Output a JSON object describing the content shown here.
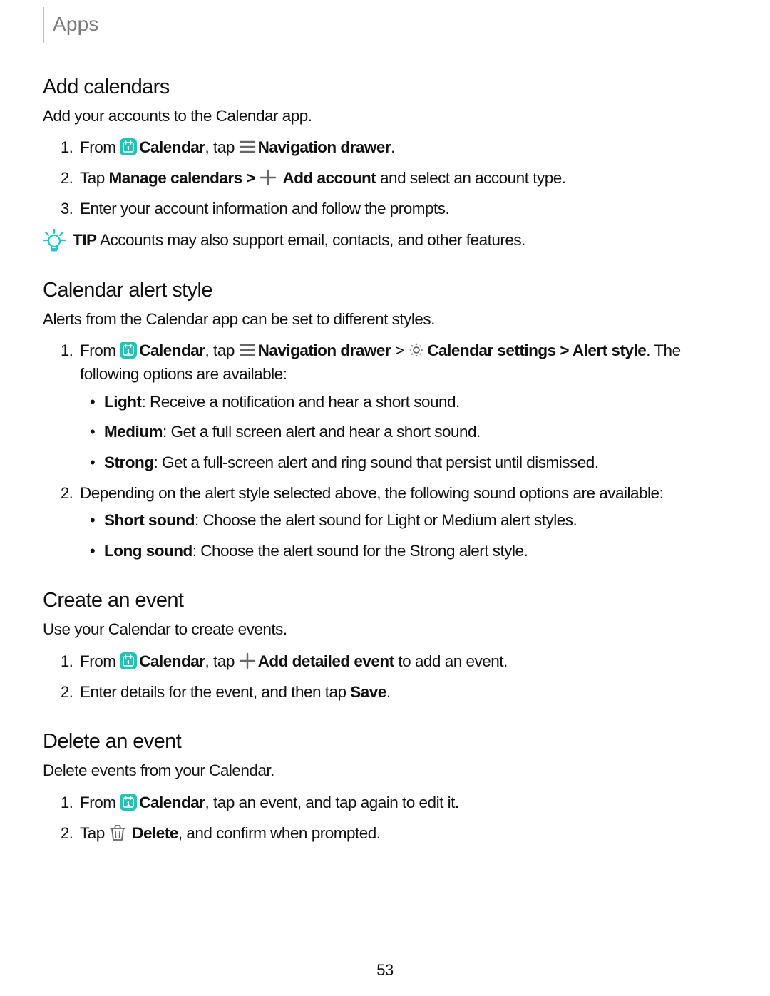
{
  "breadcrumb": "Apps",
  "pageNumber": "53",
  "tipLabel": "TIP",
  "s1": {
    "heading": "Add calendars",
    "intro": "Add your accounts to the Calendar app.",
    "step1_a": "From ",
    "step1_b": "Calendar",
    "step1_c": ", tap ",
    "step1_d": "Navigation drawer",
    "step1_e": ".",
    "step2_a": "Tap ",
    "step2_b": "Manage calendars > ",
    "step2_c": "Add account",
    "step2_d": " and select an account type.",
    "step3": "Enter your account information and follow the prompts.",
    "tip": "Accounts may also support email, contacts, and other features."
  },
  "s2": {
    "heading": "Calendar alert style",
    "intro": "Alerts from the Calendar app can be set to different styles.",
    "step1_a": "From ",
    "step1_b": "Calendar",
    "step1_c": ", tap ",
    "step1_d": "Navigation drawer",
    "step1_e": " > ",
    "step1_f": "Calendar settings > Alert style",
    "step1_g": ". The following options are available:",
    "b1_a": "Light",
    "b1_b": ": Receive a notification and hear a short sound.",
    "b2_a": "Medium",
    "b2_b": ": Get a full screen alert and hear a short sound.",
    "b3_a": "Strong",
    "b3_b": ": Get a full-screen alert and ring sound that persist until dismissed.",
    "step2": "Depending on the alert style selected above, the following sound options are available:",
    "b4_a": "Short sound",
    "b4_b": ": Choose the alert sound for Light or Medium alert styles.",
    "b5_a": "Long sound",
    "b5_b": ": Choose the alert sound for the Strong alert style."
  },
  "s3": {
    "heading": "Create an event",
    "intro": "Use your Calendar to create events.",
    "step1_a": "From ",
    "step1_b": "Calendar",
    "step1_c": ", tap ",
    "step1_d": "Add detailed event",
    "step1_e": " to add an event.",
    "step2_a": "Enter details for the event, and then tap ",
    "step2_b": "Save",
    "step2_c": "."
  },
  "s4": {
    "heading": "Delete an event",
    "intro": "Delete events from your Calendar.",
    "step1_a": "From ",
    "step1_b": "Calendar",
    "step1_c": ", tap an event, and tap again to edit it.",
    "step2_a": "Tap ",
    "step2_b": "Delete",
    "step2_c": ", and confirm when prompted."
  }
}
